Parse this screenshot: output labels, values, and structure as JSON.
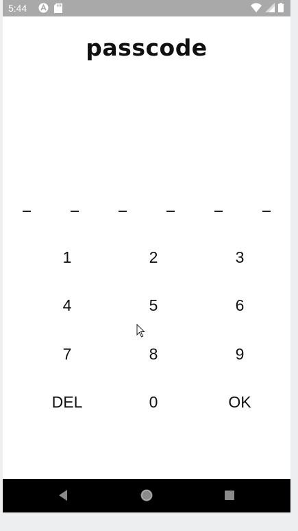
{
  "status_bar": {
    "time": "5:44",
    "left_icons": [
      "app-notification-icon",
      "sd-card-icon"
    ],
    "right_icons": [
      "wifi-icon",
      "cell-signal-icon",
      "battery-icon"
    ],
    "background": "#a9a9a9"
  },
  "title": "passcode",
  "pin": {
    "length": 6,
    "slots": [
      "_",
      "_",
      "_",
      "_",
      "_",
      "_"
    ]
  },
  "keypad": {
    "rows": [
      [
        "1",
        "2",
        "3"
      ],
      [
        "4",
        "5",
        "6"
      ],
      [
        "7",
        "8",
        "9"
      ],
      [
        "DEL",
        "0",
        "OK"
      ]
    ]
  },
  "nav_bar": {
    "buttons": [
      "back-icon",
      "home-icon",
      "recents-icon"
    ],
    "background": "#000000"
  }
}
